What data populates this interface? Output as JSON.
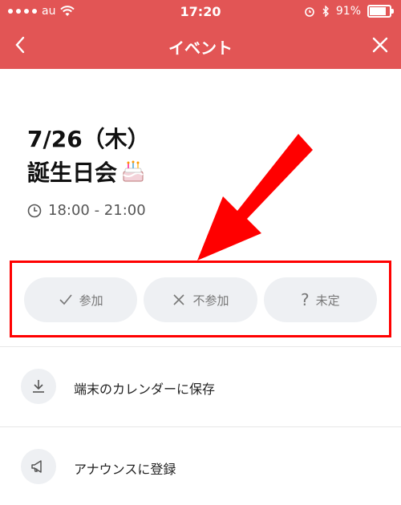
{
  "statusbar": {
    "carrier": "au",
    "time": "17:20",
    "battery": "91%"
  },
  "nav": {
    "title": "イベント"
  },
  "event": {
    "date": "7/26（木）",
    "title": "誕生日会",
    "time": "18:00 - 21:00"
  },
  "rsvp": {
    "attend": "参加",
    "decline": "不参加",
    "undecided": "未定"
  },
  "actions": {
    "save_calendar": "端末のカレンダーに保存",
    "register_announce": "アナウンスに登録"
  },
  "colors": {
    "header": "#e25555",
    "highlight": "#ff0000",
    "button_bg": "#eef0f3"
  }
}
